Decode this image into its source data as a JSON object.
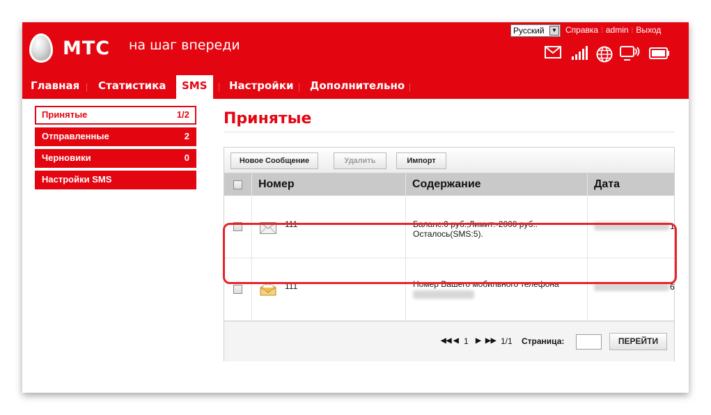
{
  "header": {
    "brand": "МТС",
    "slogan": "на шаг впереди",
    "language": "Русский",
    "links": [
      "Справка",
      "admin",
      "Выход"
    ]
  },
  "icons": [
    "mail-icon",
    "signal-icon",
    "globe-icon",
    "monitor-wifi-icon",
    "battery-icon"
  ],
  "nav": {
    "items": [
      "Главная",
      "Статистика",
      "SMS",
      "Настройки",
      "Дополнительно"
    ],
    "active": "SMS"
  },
  "sidebar": {
    "items": [
      {
        "label": "Принятые",
        "count": "1/2"
      },
      {
        "label": "Отправленные",
        "count": "2"
      },
      {
        "label": "Черновики",
        "count": "0"
      },
      {
        "label": "Настройки SMS",
        "count": ""
      }
    ]
  },
  "main": {
    "title": "Принятые",
    "toolbar": {
      "new_message": "Новое Сообщение",
      "delete": "Удалить",
      "import": "Импорт"
    },
    "columns": [
      "Номер",
      "Содержание",
      "Дата"
    ],
    "rows": [
      {
        "number": "111",
        "content_line1": "Баланс:0 руб.;Лимит:-2000 руб..",
        "content_line2": "Осталось(SMS:5).",
        "date_tail": "1",
        "read": true
      },
      {
        "number": "111",
        "content_line1": "Номер Вашего мобильного телефона",
        "content_line2": "",
        "date_tail": "6",
        "read": false
      }
    ],
    "pager": {
      "current": "1",
      "of": "1/1",
      "page_label": "Страница:",
      "go_label": "ПЕРЕЙТИ"
    }
  }
}
